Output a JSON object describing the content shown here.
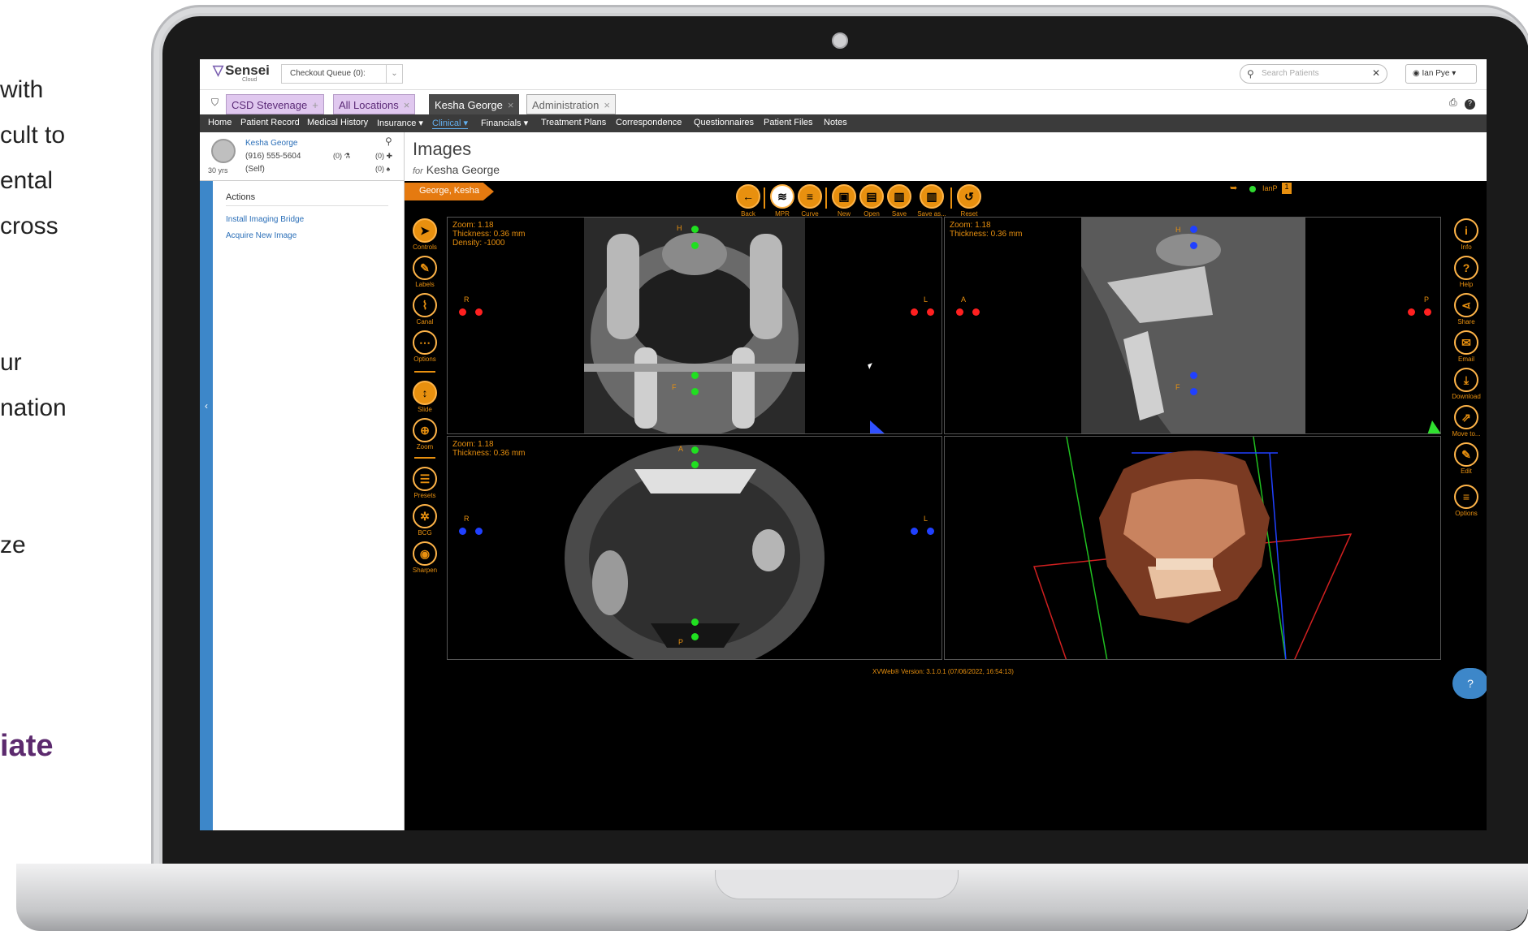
{
  "marketing": {
    "line1": "with",
    "line2": "cult to",
    "line3": "ental",
    "line4": "cross",
    "line5": "ur",
    "line6": "nation",
    "line7": "ze",
    "bold": "iate"
  },
  "app": {
    "logo": "Sensei",
    "logo_sub": "Cloud",
    "checkout": "Checkout Queue (0):",
    "search_placeholder": "Search Patients",
    "user": "Ian Pye"
  },
  "tabs": [
    {
      "label": "CSD Stevenage",
      "suffix": "+"
    },
    {
      "label": "All Locations",
      "suffix": "×"
    },
    {
      "label": "Kesha George",
      "suffix": "×"
    },
    {
      "label": "Administration",
      "suffix": "×"
    }
  ],
  "nav": [
    "Home",
    "Patient Record",
    "Medical History",
    "Insurance ▾",
    "Clinical ▾",
    "Financials ▾",
    "Treatment Plans",
    "Correspondence",
    "Questionnaires",
    "Patient Files",
    "Notes"
  ],
  "patient": {
    "name": "Kesha George",
    "phone": "(916) 555-5604",
    "relation": "(Self)",
    "age": "30 yrs",
    "count1": "(0)",
    "count2": "(0)",
    "count3": "(0)"
  },
  "page": {
    "title": "Images",
    "for_label": "for",
    "subtitle": "Kesha George"
  },
  "sidebar": {
    "heading": "Actions",
    "items": [
      "Install Imaging Bridge",
      "Acquire New Image"
    ]
  },
  "viewer": {
    "breadcrumb": "George, Kesha",
    "toolbar": [
      {
        "label": "Back",
        "icon": "arrow-left-icon",
        "glyph": "←"
      },
      {
        "label": "MPR",
        "icon": "layers-icon",
        "glyph": "≋"
      },
      {
        "label": "Curve",
        "icon": "curve-icon",
        "glyph": "≡"
      },
      {
        "label": "New",
        "icon": "folder-icon",
        "glyph": "▣"
      },
      {
        "label": "Open",
        "icon": "file-icon",
        "glyph": "▤"
      },
      {
        "label": "Save",
        "icon": "save-icon",
        "glyph": "▥"
      },
      {
        "label": "Save as...",
        "icon": "save-as-icon",
        "glyph": "▥"
      },
      {
        "label": "Reset",
        "icon": "reset-icon",
        "glyph": "↺"
      }
    ],
    "left_tools": [
      {
        "label": "Controls",
        "icon": "pointer-icon",
        "glyph": "➤"
      },
      {
        "label": "Labels",
        "icon": "pencil-icon",
        "glyph": "✎"
      },
      {
        "label": "Canal",
        "icon": "canal-icon",
        "glyph": "⌇"
      },
      {
        "label": "Options",
        "icon": "more-icon",
        "glyph": "⋯"
      },
      {
        "label": "Slide",
        "icon": "slide-icon",
        "glyph": "↕"
      },
      {
        "label": "Zoom",
        "icon": "zoom-icon",
        "glyph": "⊕"
      },
      {
        "label": "Presets",
        "icon": "sliders-icon",
        "glyph": "☰"
      },
      {
        "label": "BCG",
        "icon": "bcg-icon",
        "glyph": "✲"
      },
      {
        "label": "Sharpen",
        "icon": "eye-icon",
        "glyph": "◉"
      }
    ],
    "right_tools": [
      {
        "label": "Info",
        "icon": "info-icon",
        "glyph": "i"
      },
      {
        "label": "Help",
        "icon": "help-icon",
        "glyph": "?"
      },
      {
        "label": "Share",
        "icon": "share-icon",
        "glyph": "⋖"
      },
      {
        "label": "Email",
        "icon": "email-icon",
        "glyph": "✉"
      },
      {
        "label": "Download",
        "icon": "download-icon",
        "glyph": "⤓"
      },
      {
        "label": "Move to...",
        "icon": "move-icon",
        "glyph": "⇗"
      },
      {
        "label": "Edit",
        "icon": "edit-icon",
        "glyph": "✎"
      },
      {
        "label": "Options",
        "icon": "menu-icon",
        "glyph": "≡"
      }
    ],
    "status_user": "IanP",
    "status_badge": "1",
    "panels": {
      "coronal": {
        "overlay": "Zoom: 1.18\nThickness: 0.36 mm\nDensity: -1000",
        "top": "H",
        "bottom": "F",
        "left": "R",
        "right": "L"
      },
      "sagittal": {
        "overlay": "Zoom: 1.18\nThickness: 0.36 mm",
        "top": "H",
        "bottom": "F",
        "left": "A",
        "right": "P"
      },
      "axial": {
        "overlay": "Zoom: 1.18\nThickness: 0.36 mm",
        "top": "A",
        "bottom": "P",
        "left": "R",
        "right": "L"
      }
    },
    "version": "XVWeb® Version: 3.1.0.1 (07/06/2022, 16:54:13)",
    "help_glyph": "?"
  },
  "colors": {
    "accent_orange": "#e8900f",
    "nav_bg": "#3b3b3b",
    "sidebar_blue": "#3d87c9",
    "tab_purple": "#e0c8ef",
    "marker_green": "#20e020",
    "marker_red": "#ff2020",
    "marker_blue": "#2040ff"
  }
}
